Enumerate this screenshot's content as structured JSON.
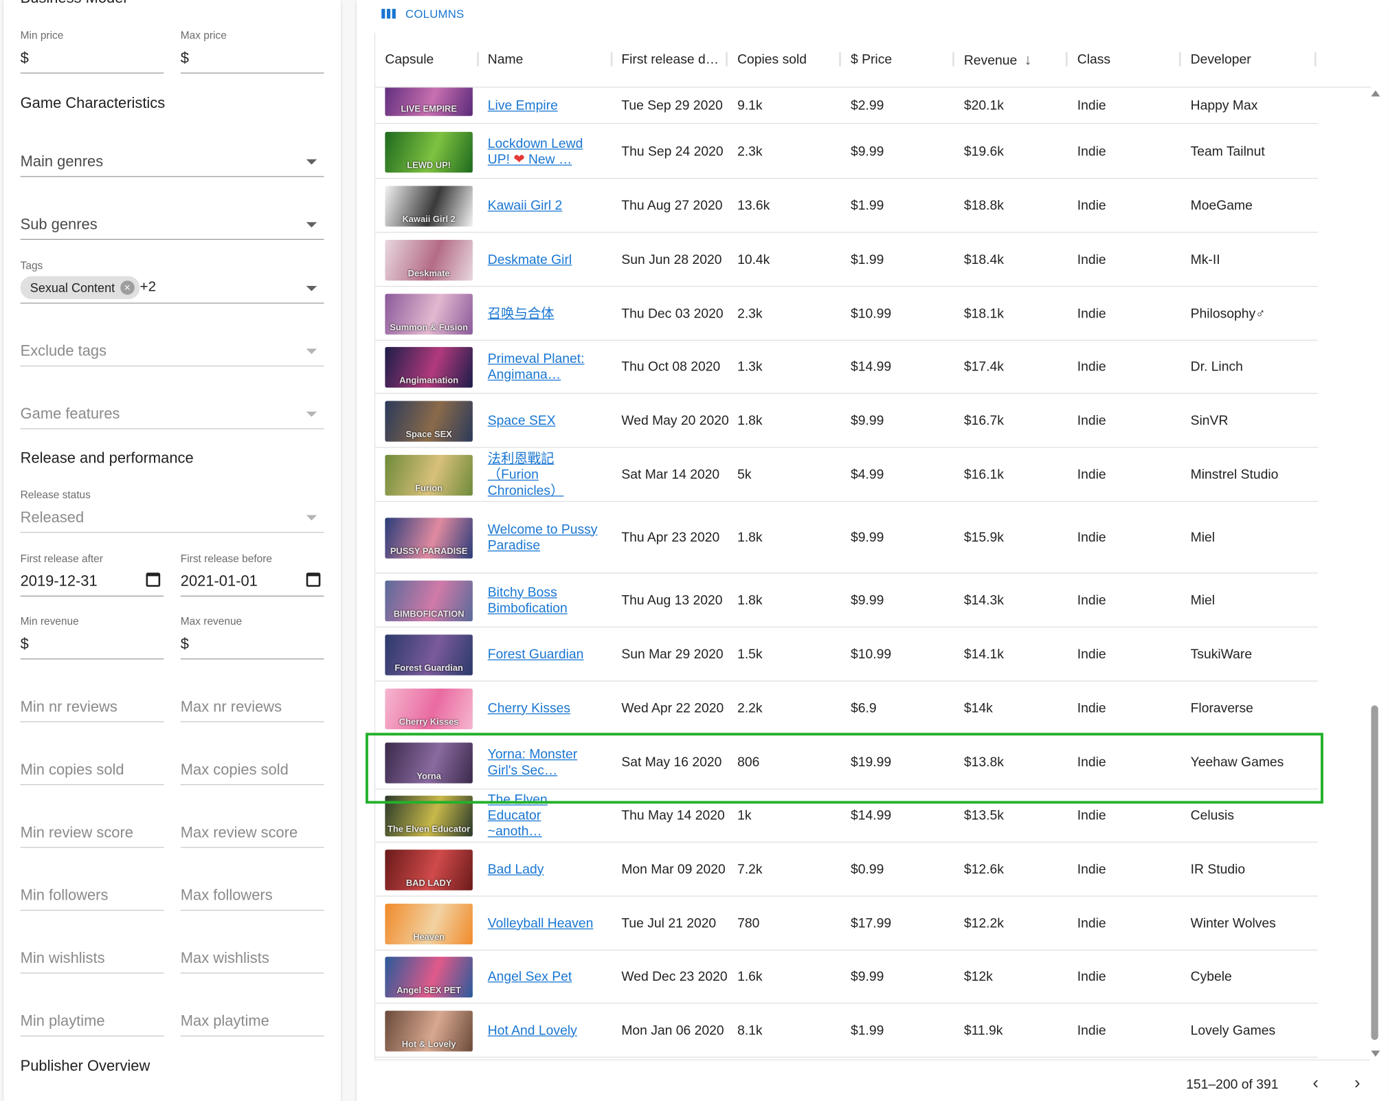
{
  "filters": {
    "business_model_title": "Business Model",
    "min_price_label": "Min price",
    "min_price_value": "$",
    "max_price_label": "Max price",
    "max_price_value": "$",
    "game_characteristics_title": "Game Characteristics",
    "main_genres_placeholder": "Main genres",
    "sub_genres_placeholder": "Sub genres",
    "tags_label": "Tags",
    "tags_chip": "Sexual Content",
    "tags_more": "+2",
    "exclude_tags_placeholder": "Exclude tags",
    "game_features_placeholder": "Game features",
    "release_performance_title": "Release and performance",
    "release_status_label": "Release status",
    "release_status_value": "Released",
    "first_release_after_label": "First release after",
    "first_release_after_value": "2019-12-31",
    "first_release_before_label": "First release before",
    "first_release_before_value": "2021-01-01",
    "min_revenue_label": "Min revenue",
    "min_revenue_value": "$",
    "max_revenue_label": "Max revenue",
    "max_revenue_value": "$",
    "min_reviews_placeholder": "Min nr reviews",
    "max_reviews_placeholder": "Max nr reviews",
    "min_copies_placeholder": "Min copies sold",
    "max_copies_placeholder": "Max copies sold",
    "min_score_placeholder": "Min review score",
    "max_score_placeholder": "Max review score",
    "min_followers_placeholder": "Min followers",
    "max_followers_placeholder": "Max followers",
    "min_wishlists_placeholder": "Min wishlists",
    "max_wishlists_placeholder": "Max wishlists",
    "min_playtime_placeholder": "Min playtime",
    "max_playtime_placeholder": "Max playtime",
    "publisher_overview_title": "Publisher Overview"
  },
  "toolbar": {
    "columns_label": "COLUMNS"
  },
  "table": {
    "columns": [
      "Capsule",
      "Name",
      "First release d…",
      "Copies sold",
      "$ Price",
      "Revenue",
      "Class",
      "Developer"
    ],
    "sort_indicator": "↓",
    "rows": [
      {
        "capsule_text": "LIVE EMPIRE",
        "capsule_colors": "#5a2a7a,#c86fb0",
        "name": "Live Empire",
        "name_line2": "",
        "name_line3": "",
        "release": "Tue Sep 29 2020",
        "copies": "9.1k",
        "price": "$2.99",
        "revenue": "$20.1k",
        "class": "Indie",
        "developer": "Happy Max"
      },
      {
        "capsule_text": "LEWD UP!",
        "capsule_colors": "#1e6a1e,#7fc241",
        "name": "Lockdown Lewd",
        "name_line2": "UP! ❤ New …",
        "name_line3": "",
        "release": "Thu Sep 24 2020",
        "copies": "2.3k",
        "price": "$9.99",
        "revenue": "$19.6k",
        "class": "Indie",
        "developer": "Team Tailnut"
      },
      {
        "capsule_text": "Kawaii Girl 2",
        "capsule_colors": "#f2f2f2,#3a3a3a",
        "name": "Kawaii Girl 2",
        "name_line2": "",
        "name_line3": "",
        "release": "Thu Aug 27 2020",
        "copies": "13.6k",
        "price": "$1.99",
        "revenue": "$18.8k",
        "class": "Indie",
        "developer": "MoeGame"
      },
      {
        "capsule_text": "Deskmate",
        "capsule_colors": "#e8d7de,#b46b86",
        "name": "Deskmate Girl",
        "name_line2": "",
        "name_line3": "",
        "release": "Sun Jun 28 2020",
        "copies": "10.4k",
        "price": "$1.99",
        "revenue": "$18.4k",
        "class": "Indie",
        "developer": "Mk-II"
      },
      {
        "capsule_text": "Summon & Fusion",
        "capsule_colors": "#8b5a9b,#e2b8cf",
        "name": "召唤与合体",
        "name_line2": "",
        "name_line3": "",
        "release": "Thu Dec 03 2020",
        "copies": "2.3k",
        "price": "$10.99",
        "revenue": "$18.1k",
        "class": "Indie",
        "developer": "Philosophy♂"
      },
      {
        "capsule_text": "Angimanation",
        "capsule_colors": "#1d1d4a,#b23a7c",
        "name": "Primeval Planet:",
        "name_line2": "Angimana…",
        "name_line3": "",
        "release": "Thu Oct 08 2020",
        "copies": "1.3k",
        "price": "$14.99",
        "revenue": "$17.4k",
        "class": "Indie",
        "developer": "Dr. Linch"
      },
      {
        "capsule_text": "Space SEX",
        "capsule_colors": "#2b3a5a,#8a6a4a",
        "name": "Space SEX",
        "name_line2": "",
        "name_line3": "",
        "release": "Wed May 20 2020",
        "copies": "1.8k",
        "price": "$9.99",
        "revenue": "$16.7k",
        "class": "Indie",
        "developer": "SinVR"
      },
      {
        "capsule_text": "Furion",
        "capsule_colors": "#6e8a3a,#d8c07a",
        "name": "法利恩戰記",
        "name_line2": "（Furion",
        "name_line3": "Chronicles）",
        "release": "Sat Mar 14 2020",
        "copies": "5k",
        "price": "$4.99",
        "revenue": "$16.1k",
        "class": "Indie",
        "developer": "Minstrel Studio"
      },
      {
        "capsule_text": "PUSSY PARADISE",
        "capsule_colors": "#2a3c7a,#e08aa0",
        "name": "Welcome to Pussy",
        "name_line2": "Paradise",
        "name_line3": "",
        "release": "Thu Apr 23 2020",
        "copies": "1.8k",
        "price": "$9.99",
        "revenue": "$15.9k",
        "class": "Indie",
        "developer": "Miel"
      },
      {
        "capsule_text": "BIMBOFICATION",
        "capsule_colors": "#5a6a9a,#d07aa8",
        "name": "Bitchy Boss",
        "name_line2": "Bimbofication",
        "name_line3": "",
        "release": "Thu Aug 13 2020",
        "copies": "1.8k",
        "price": "$9.99",
        "revenue": "$14.3k",
        "class": "Indie",
        "developer": "Miel"
      },
      {
        "capsule_text": "Forest Guardian",
        "capsule_colors": "#2a3a6a,#7a5a9a",
        "name": "Forest Guardian",
        "name_line2": "",
        "name_line3": "",
        "release": "Sun Mar 29 2020",
        "copies": "1.5k",
        "price": "$10.99",
        "revenue": "$14.1k",
        "class": "Indie",
        "developer": "TsukiWare"
      },
      {
        "capsule_text": "Cherry Kisses",
        "capsule_colors": "#f6b6d0,#e96aa0",
        "name": "Cherry Kisses",
        "name_line2": "",
        "name_line3": "",
        "release": "Wed Apr 22 2020",
        "copies": "2.2k",
        "price": "$6.9",
        "revenue": "$14k",
        "class": "Indie",
        "developer": "Floraverse"
      },
      {
        "capsule_text": "Yorna",
        "capsule_colors": "#3a2a4a,#8a6aa0",
        "name": "Yorna: Monster",
        "name_line2": "Girl's Sec…",
        "name_line3": "",
        "release": "Sat May 16 2020",
        "copies": "806",
        "price": "$19.99",
        "revenue": "$13.8k",
        "class": "Indie",
        "developer": "Yeehaw Games"
      },
      {
        "capsule_text": "The Elven Educator",
        "capsule_colors": "#2a3a2a,#c8b84a",
        "name": "The Elven Educator",
        "name_line2": "~anoth…",
        "name_line3": "",
        "release": "Thu May 14 2020",
        "copies": "1k",
        "price": "$14.99",
        "revenue": "$13.5k",
        "class": "Indie",
        "developer": "Celusis"
      },
      {
        "capsule_text": "BAD LADY",
        "capsule_colors": "#6a1a1a,#d04a4a",
        "name": "Bad Lady",
        "name_line2": "",
        "name_line3": "",
        "release": "Mon Mar 09 2020",
        "copies": "7.2k",
        "price": "$0.99",
        "revenue": "$12.6k",
        "class": "Indie",
        "developer": "IR Studio"
      },
      {
        "capsule_text": "Heaven",
        "capsule_colors": "#f08a2a,#f2d2a2",
        "name": "Volleyball Heaven",
        "name_line2": "",
        "name_line3": "",
        "release": "Tue Jul 21 2020",
        "copies": "780",
        "price": "$17.99",
        "revenue": "$12.2k",
        "class": "Indie",
        "developer": "Winter Wolves"
      },
      {
        "capsule_text": "Angel SEX PET",
        "capsule_colors": "#2a5a9a,#e05a8a",
        "name": "Angel Sex Pet",
        "name_line2": "",
        "name_line3": "",
        "release": "Wed Dec 23 2020",
        "copies": "1.6k",
        "price": "$9.99",
        "revenue": "$12k",
        "class": "Indie",
        "developer": "Cybele"
      },
      {
        "capsule_text": "Hot & Lovely",
        "capsule_colors": "#6a4a3a,#d8a890",
        "name": "Hot And Lovely",
        "name_line2": "",
        "name_line3": "",
        "release": "Mon Jan 06 2020",
        "copies": "8.1k",
        "price": "$1.99",
        "revenue": "$11.9k",
        "class": "Indie",
        "developer": "Lovely Games"
      }
    ]
  },
  "footer": {
    "page_range": "151–200 of 391",
    "prev_icon": "‹",
    "next_icon": "›"
  },
  "colors": {
    "link": "#1976d2",
    "highlight": "#22b12a"
  }
}
